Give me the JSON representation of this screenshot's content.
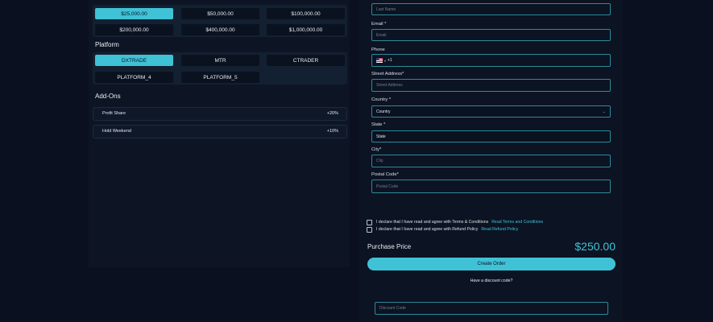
{
  "account_sizes": [
    "$25,000.00",
    "$50,000.00",
    "$100,000.00",
    "$200,000.00",
    "$400,000.00",
    "$1,000,000.00"
  ],
  "platform": {
    "title": "Platform",
    "options": [
      "DXTRADE",
      "MTR",
      "CTRADER",
      "PLATFORM_4",
      "PLATFORM_5"
    ]
  },
  "addons": {
    "title": "Add-Ons",
    "items": [
      {
        "name": "Profit Share",
        "price": "+20%"
      },
      {
        "name": "Hold Weekend",
        "price": "+10%"
      }
    ]
  },
  "form": {
    "last_name_placeholder": "Last Name",
    "email_label": "Email *",
    "email_placeholder": "Email",
    "phone_label": "Phone",
    "phone_code": "+1",
    "street_label": "Street Address*",
    "street_placeholder": "Street Address",
    "country_label": "Country *",
    "country_value": "Country",
    "state_label": "State *",
    "state_value": "State",
    "city_label": "City*",
    "city_placeholder": "City",
    "postal_label": "Postal Code*",
    "postal_placeholder": "Postal Code"
  },
  "terms": {
    "text": "I declare that I have read and agree with Terms & Conditions",
    "link": "Read Terms and Conditions"
  },
  "refund": {
    "text": "I declare that I have read and agree with Refund Policy",
    "link": "Read Refund Policy"
  },
  "purchase": {
    "label": "Purchase Price",
    "price": "$250.00",
    "button": "Create Order",
    "discount_prompt": "Have a discount code?",
    "discount_placeholder": "Discount Code"
  },
  "colors": {
    "accent": "#40c2d6",
    "background": "#0b1020",
    "panel": "#0c1322"
  }
}
